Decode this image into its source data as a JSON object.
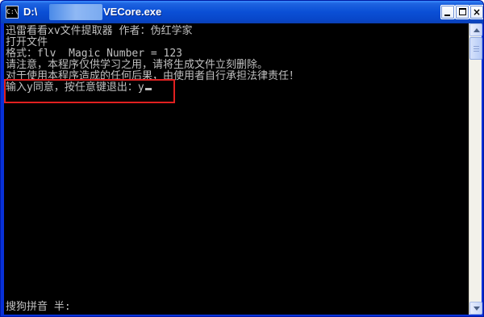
{
  "window": {
    "title_prefix": "D:\\",
    "title_suffix": "VECore.exe",
    "app_icon_text": "C:\\",
    "controls": {
      "minimize": "minimize",
      "maximize": "maximize",
      "close": "×"
    }
  },
  "console": {
    "lines": [
      "迅雷看看xv文件提取器 作者：伪红学家",
      "打开文件",
      "格式：flv  Magic Number = 123",
      "请注意，本程序仅供学习之用，请将生成文件立刻删除。",
      "对于使用本程序造成的任何后果，由使用者自行承担法律责任！",
      "输入y同意，按任意键退出：y"
    ],
    "ime_status": "搜狗拼音 半:"
  },
  "colors": {
    "console_bg": "#000000",
    "console_text": "#c0c0c0",
    "titlebar": "#0a4fd6",
    "highlight": "#e02020"
  }
}
